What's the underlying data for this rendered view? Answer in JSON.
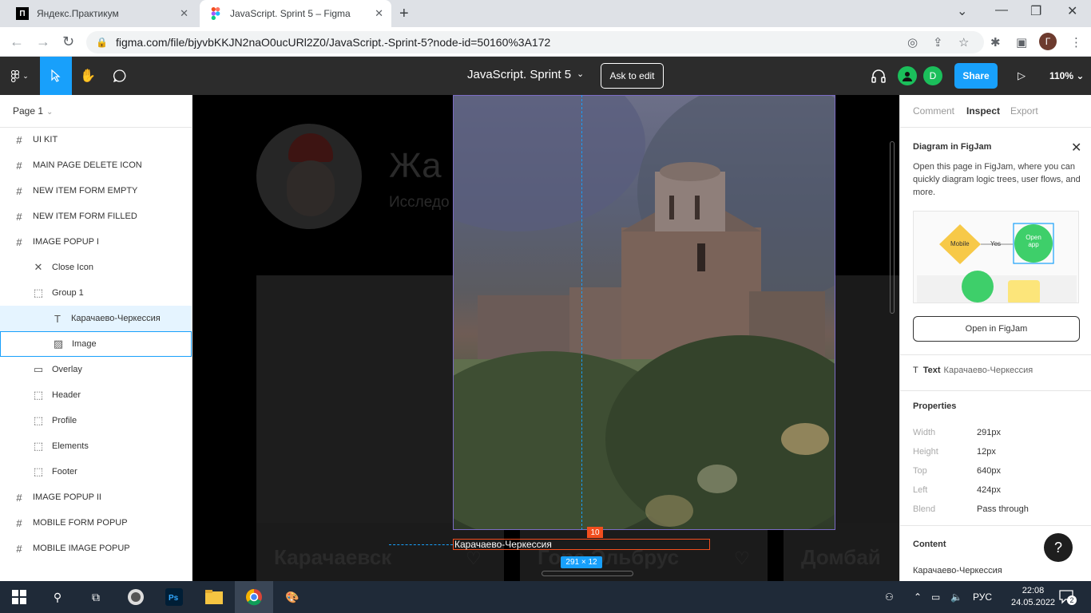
{
  "browser": {
    "tabs": [
      {
        "title": "Яндекс.Практикум",
        "favicon": "П"
      },
      {
        "title": "JavaScript. Sprint 5 – Figma",
        "favicon": "figma"
      }
    ],
    "url": "figma.com/file/bjyvbKKJN2naO0ucURl2Z0/JavaScript.-Sprint-5?node-id=50160%3A172",
    "profile_initial": "Г"
  },
  "figma": {
    "file_title": "JavaScript. Sprint 5",
    "ask_to_edit": "Ask to edit",
    "share": "Share",
    "zoom": "110%",
    "user_initial": "D"
  },
  "layers": {
    "page": "Page 1",
    "items": [
      {
        "label": "UI KIT",
        "icon": "frame-icon",
        "indent": 0
      },
      {
        "label": "MAIN PAGE DELETE ICON",
        "icon": "frame-icon",
        "indent": 0
      },
      {
        "label": "NEW ITEM FORM EMPTY",
        "icon": "frame-icon",
        "indent": 0
      },
      {
        "label": "NEW ITEM FORM FILLED",
        "icon": "frame-icon",
        "indent": 0
      },
      {
        "label": "IMAGE POPUP I",
        "icon": "frame-icon",
        "indent": 0
      },
      {
        "label": "Close Icon",
        "icon": "close-icon",
        "indent": 1
      },
      {
        "label": "Group 1",
        "icon": "group-icon",
        "indent": 1
      },
      {
        "label": "Карачаево-Черкессия",
        "icon": "text-icon",
        "indent": 2
      },
      {
        "label": "Image",
        "icon": "image-icon",
        "indent": 2
      },
      {
        "label": "Overlay",
        "icon": "rectangle-icon",
        "indent": 1
      },
      {
        "label": "Header",
        "icon": "group-icon",
        "indent": 1
      },
      {
        "label": "Profile",
        "icon": "group-icon",
        "indent": 1
      },
      {
        "label": "Elements",
        "icon": "group-icon",
        "indent": 1
      },
      {
        "label": "Footer",
        "icon": "group-icon",
        "indent": 1
      },
      {
        "label": "IMAGE POPUP II",
        "icon": "frame-icon",
        "indent": 0
      },
      {
        "label": "MOBILE FORM POPUP",
        "icon": "frame-icon",
        "indent": 0
      },
      {
        "label": "MOBILE IMAGE POPUP",
        "icon": "frame-icon",
        "indent": 0
      }
    ]
  },
  "canvas": {
    "bg_title": "Жа",
    "bg_subtitle": "Исследо",
    "card_titles": [
      "Карачаевск",
      "Гора Эльбрус",
      "Домбай"
    ],
    "caption": "Карачаево-Черкессия",
    "spacing_badge": "10",
    "size_badge": "291 × 12"
  },
  "inspect": {
    "tabs": [
      "Comment",
      "Inspect",
      "Export"
    ],
    "figjam_title": "Diagram in FigJam",
    "figjam_desc": "Open this page in FigJam, where you can quickly diagram logic trees, user flows, and more.",
    "figjam_mobile": "Mobile",
    "figjam_yes": "Yes",
    "figjam_open_app": "Open app",
    "open_figjam": "Open in FigJam",
    "text_label": "Text",
    "text_value": "Карачаево-Черкессия",
    "properties_title": "Properties",
    "properties": [
      {
        "key": "Width",
        "value": "291px"
      },
      {
        "key": "Height",
        "value": "12px"
      },
      {
        "key": "Top",
        "value": "640px"
      },
      {
        "key": "Left",
        "value": "424px"
      },
      {
        "key": "Blend",
        "value": "Pass through"
      }
    ],
    "content_title": "Content",
    "content_value": "Карачаево-Черкессия",
    "help": "?"
  },
  "taskbar": {
    "lang": "РУС",
    "time": "22:08",
    "date": "24.05.2022",
    "notifications": "2"
  },
  "colors": {
    "figma_blue": "#18a0fb",
    "figma_dark": "#2c2c2c",
    "measure_red": "#f24e1e",
    "selection_purple": "#7b6cc4"
  }
}
